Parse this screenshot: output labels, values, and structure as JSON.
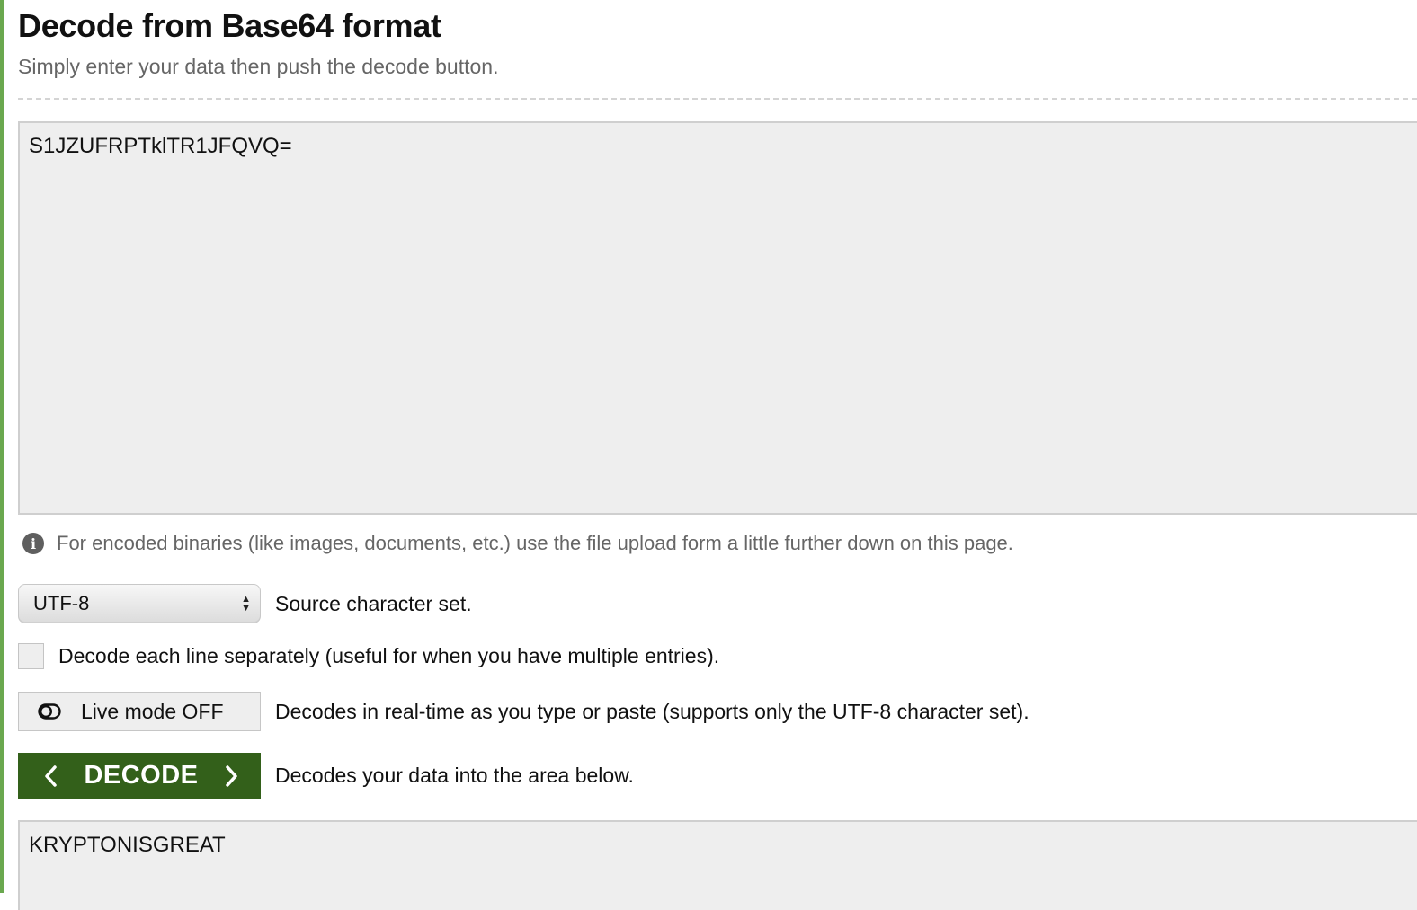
{
  "header": {
    "title": "Decode from Base64 format",
    "subtitle": "Simply enter your data then push the decode button."
  },
  "input": {
    "value": "S1JZUFRPTklTR1JFQVQ="
  },
  "info": {
    "icon": "info-icon",
    "text": "For encoded binaries (like images, documents, etc.) use the file upload form a little further down on this page."
  },
  "charset": {
    "selected": "UTF-8",
    "label": "Source character set."
  },
  "per_line": {
    "checked": false,
    "label": "Decode each line separately (useful for when you have multiple entries)."
  },
  "live_mode": {
    "icon": "toggle-off-icon",
    "button_label": "Live mode OFF",
    "description": "Decodes in real-time as you type or paste (supports only the UTF-8 character set)."
  },
  "decode": {
    "button_label": "DECODE",
    "description": "Decodes your data into the area below."
  },
  "output": {
    "value": "KRYPTONISGREAT"
  },
  "colors": {
    "accent_bar": "#6aa84f",
    "decode_button": "#33601a",
    "field_background": "#eeeeee"
  }
}
